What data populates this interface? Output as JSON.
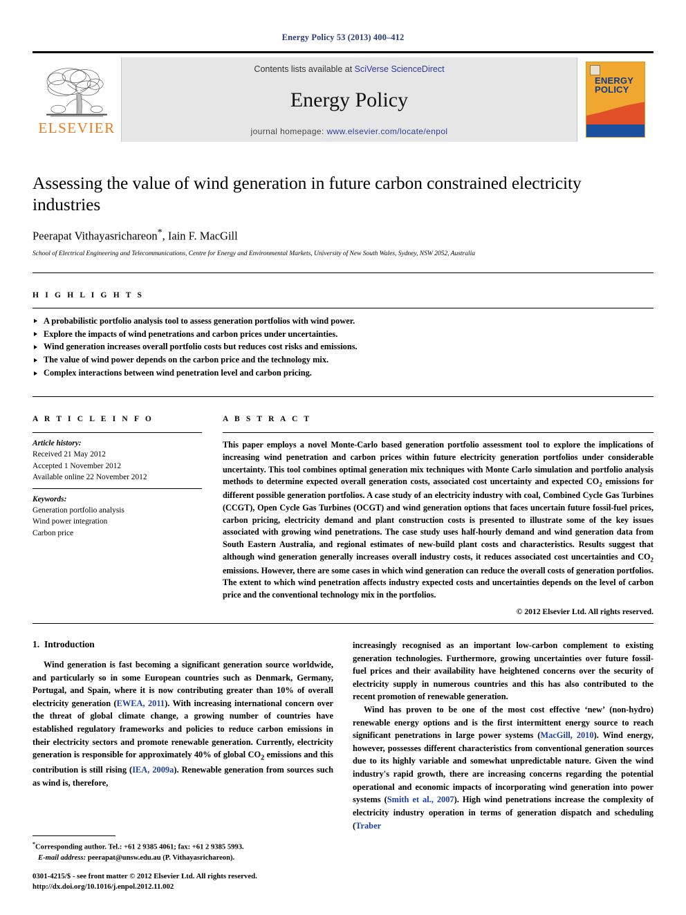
{
  "running_head": "Energy Policy 53 (2013) 400–412",
  "masthead": {
    "publisher_name": "ELSEVIER",
    "contents_prefix": "Contents lists available at ",
    "contents_link": "SciVerse ScienceDirect",
    "journal_title": "Energy Policy",
    "homepage_prefix": "journal homepage: ",
    "homepage_url": "www.elsevier.com/locate/enpol",
    "cover_title_line1": "ENERGY",
    "cover_title_line2": "POLICY",
    "colors": {
      "elsevier_orange": "#e87b1e",
      "link_blue": "#2a3a9c",
      "cover_orange": "#f0a830",
      "cover_red": "#e2502a",
      "cover_blue": "#1b4fa0",
      "masthead_grey": "#e6e6e6",
      "running_head_blue": "#2a3a7c"
    }
  },
  "title": "Assessing the value of wind generation in future carbon constrained electricity industries",
  "authors": "Peerapat Vithayasrichareon",
  "authors_rest": ", Iain F. MacGill",
  "affiliation": "School of Electrical Engineering and Telecommunications, Centre for Energy and Environmental Markets, University of New South Wales, Sydney, NSW 2052, Australia",
  "highlights": {
    "label": "H I G H L I G H T S",
    "items": [
      "A probabilistic portfolio analysis tool to assess generation portfolios with wind power.",
      "Explore the impacts of wind penetrations and carbon prices under uncertainties.",
      "Wind generation increases overall portfolio costs but reduces cost risks and emissions.",
      "The value of wind power depends on the carbon price and the technology mix.",
      "Complex interactions between wind penetration level and carbon pricing."
    ]
  },
  "article_info": {
    "label": "A R T I C L E   I N F O",
    "history_label": "Article history:",
    "history": [
      "Received 21 May 2012",
      "Accepted 1 November 2012",
      "Available online 22 November 2012"
    ],
    "keywords_label": "Keywords:",
    "keywords": [
      "Generation portfolio analysis",
      "Wind power integration",
      "Carbon price"
    ]
  },
  "abstract": {
    "label": "A B S T R A C T",
    "part1": "This paper employs a novel Monte-Carlo based generation portfolio assessment tool to explore the implications of increasing wind penetration and carbon prices within future electricity generation portfolios under considerable uncertainty. This tool combines optimal generation mix techniques with Monte Carlo simulation and portfolio analysis methods to determine expected overall generation costs, associated cost uncertainty and expected CO",
    "sub1": "2",
    "part2": " emissions for different possible generation portfolios. A case study of an electricity industry with coal, Combined Cycle Gas Turbines (CCGT), Open Cycle Gas Turbines (OCGT) and wind generation options that faces uncertain future fossil-fuel prices, carbon pricing, electricity demand and plant construction costs is presented to illustrate some of the key issues associated with growing wind penetrations. The case study uses half-hourly demand and wind generation data from South Eastern Australia, and regional estimates of new-build plant costs and characteristics. Results suggest that although wind generation generally increases overall industry costs, it reduces associated cost uncertainties and CO",
    "sub2": "2",
    "part3": " emissions. However, there are some cases in which wind generation can reduce the overall costs of generation portfolios. The extent to which wind penetration affects industry expected costs and uncertainties depends on the level of carbon price and the conventional technology mix in the portfolios.",
    "copyright": "© 2012 Elsevier Ltd. All rights reserved."
  },
  "body": {
    "section_number": "1.",
    "section_title": "Introduction",
    "left_para1_a": "Wind generation is fast becoming a significant generation source worldwide, and particularly so in some European countries such as Denmark, Germany, Portugal, and Spain, where it is now contributing greater than 10% of overall electricity generation (",
    "left_cite1": "EWEA, 2011",
    "left_para1_b": "). With increasing international concern over the threat of global climate change, a growing number of countries have established regulatory frameworks and policies to reduce carbon emissions in their electricity sectors and promote renewable generation. Currently, electricity generation is responsible for approximately 40% of global CO",
    "left_sub": "2",
    "left_para1_c": " emissions and this contribution is still rising (",
    "left_cite2": "IEA, 2009a",
    "left_para1_d": "). Renewable generation from sources such as wind is, therefore,",
    "right_para1": "increasingly recognised as an important low-carbon complement to existing generation technologies. Furthermore, growing uncertainties over future fossil-fuel prices and their availability have heightened concerns over the security of electricity supply in numerous countries and this has also contributed to the recent promotion of renewable generation.",
    "right_para2_a": "Wind has proven to be one of the most cost effective ‘new’ (non-hydro) renewable energy options and is the first intermittent energy source to reach significant penetrations in large power systems (",
    "right_cite1": "MacGill, 2010",
    "right_para2_b": "). Wind energy, however, possesses different characteristics from conventional generation sources due to its highly variable and somewhat unpredictable nature. Given the wind industry's rapid growth, there are increasing concerns regarding the potential operational and economic impacts of incorporating wind generation into power systems (",
    "right_cite2": "Smith et al., 2007",
    "right_para2_c": "). High wind penetrations increase the complexity of electricity industry operation in terms of generation dispatch and scheduling (",
    "right_cite3": "Traber"
  },
  "footnote": {
    "corresponding": "Corresponding author. Tel.: +61 2 9385 4061; fax: +61 2 9385 5993.",
    "email_label": "E-mail address:",
    "email_value": "peerapat@unsw.edu.au (P. Vithayasrichareon)."
  },
  "imprint": {
    "line1": "0301-4215/$ - see front matter © 2012 Elsevier Ltd. All rights reserved.",
    "line2": "http://dx.doi.org/10.1016/j.enpol.2012.11.002"
  }
}
